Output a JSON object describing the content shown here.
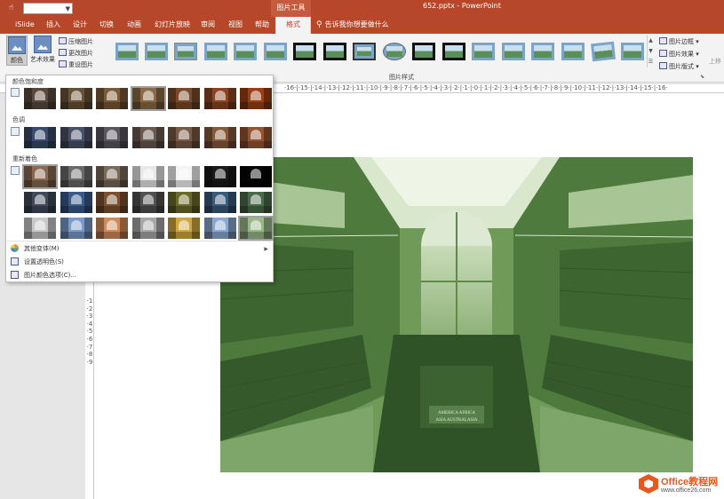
{
  "window": {
    "title": "652.pptx - PowerPoint",
    "context_tab_group": "图片工具",
    "quick_access_value": ""
  },
  "tabs": [
    {
      "label": "iSlide"
    },
    {
      "label": "插入"
    },
    {
      "label": "设计"
    },
    {
      "label": "切换"
    },
    {
      "label": "动画"
    },
    {
      "label": "幻灯片放映"
    },
    {
      "label": "审阅"
    },
    {
      "label": "视图"
    },
    {
      "label": "帮助"
    },
    {
      "label": "格式",
      "active": true
    }
  ],
  "tell_me": "告诉我你想要做什么",
  "ribbon": {
    "color_button": "颜色",
    "art_effects_button": "艺术效果",
    "compress_pictures": "压缩图片",
    "change_picture": "更改图片",
    "reset_picture": "重设图片",
    "picture_styles_group": "图片样式",
    "picture_border": "图片边框",
    "picture_effects": "图片效果",
    "picture_layout": "图片版式",
    "cut_off_label": "上移"
  },
  "ruler": {
    "horizontal": "·16·|·15·|·14·|·13·|·12·|·11·|·10·|·9·|·8·|·7·|·6·|·5·|·4·|·3·|·2·|·1·|·0·|·1·|·2·|·3·|·4·|·5·|·6·|·7·|·8·|·9·|·10·|·11·|·12·|·13·|·14·|·15·|·16·",
    "vertical": "·1·2·3·4·5·6·7·8·9"
  },
  "color_panel": {
    "saturation_title": "颜色饱和度",
    "tone_title": "色调",
    "recolor_title": "重新着色",
    "saturation_swatches": [
      "#5b4a3c",
      "#6a5239",
      "#7a5a36",
      "#8a6a46",
      "#7a4a2a",
      "#8a4520",
      "#9a4014"
    ],
    "tone_swatches": [
      "#3a4a6a",
      "#4a5068",
      "#5a5660",
      "#6a5a50",
      "#785a46",
      "#86583c",
      "#945432"
    ],
    "recolor_swatches": [
      [
        "#8a6a52",
        "#6a6a6a",
        "#7a6a5a",
        "#e8e8e8",
        "#f4f4f4",
        "#1a1a1a",
        "#050505"
      ],
      [
        "#404a5a",
        "#3a5a8a",
        "#7a5030",
        "#505050",
        "#6a6a2a",
        "#3a5a7a",
        "#4a6a4a"
      ],
      [
        "#c8c8c8",
        "#7a9ac8",
        "#d08a58",
        "#a8a8a8",
        "#d0a840",
        "#8aa8d0",
        "#98b888"
      ]
    ],
    "menu_items": [
      {
        "label": "其他变体(M)",
        "has_submenu": true
      },
      {
        "label": "设置透明色(S)",
        "has_submenu": false
      },
      {
        "label": "图片颜色选项(C)...",
        "has_submenu": false
      }
    ]
  },
  "watermark": {
    "line1": "Office教程网",
    "line2": "www.office26.com"
  }
}
